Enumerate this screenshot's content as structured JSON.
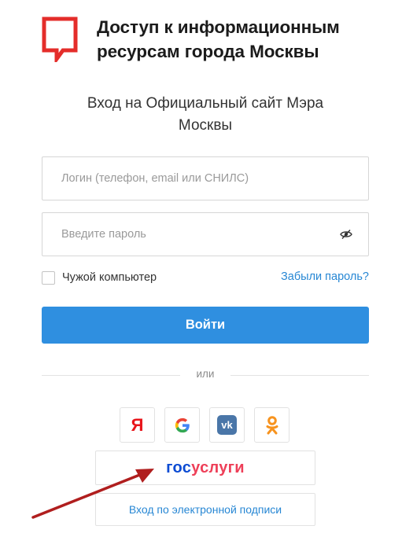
{
  "brand": {
    "title_line1": "Доступ к информационным",
    "title_line2": "ресурсам города Москвы",
    "logo_color": "#e42d2a"
  },
  "subtitle": {
    "line1": "Вход на Официальный сайт Мэра",
    "line2": "Москвы"
  },
  "login_form": {
    "login_placeholder": "Логин (телефон, email или СНИЛС)",
    "login_value": "",
    "password_placeholder": "Введите пароль",
    "password_value": "",
    "password_toggle_icon": "eye-icon",
    "remember_label": "Чужой компьютер",
    "remember_checked": false,
    "forgot_label": "Забыли пароль?",
    "submit_label": "Войти"
  },
  "alt_login": {
    "divider_text": "или",
    "social": [
      {
        "name": "yandex",
        "glyph": "Я",
        "color": "#e8151b"
      },
      {
        "name": "google",
        "icon": "google-icon"
      },
      {
        "name": "vk",
        "glyph": "vk",
        "color": "#4a76a8"
      },
      {
        "name": "odnoklassniki",
        "icon": "odnoklassniki-icon",
        "color": "#f7931e"
      }
    ],
    "gosuslugi": {
      "part1": "гос",
      "part2": "услуги",
      "color1": "#0d4cd3",
      "color2": "#ee3f58"
    },
    "esign_label": "Вход по электронной подписи"
  },
  "colors": {
    "accent": "#2f8fe0",
    "link": "#2787d4",
    "annotation_arrow": "#b01e1e"
  }
}
